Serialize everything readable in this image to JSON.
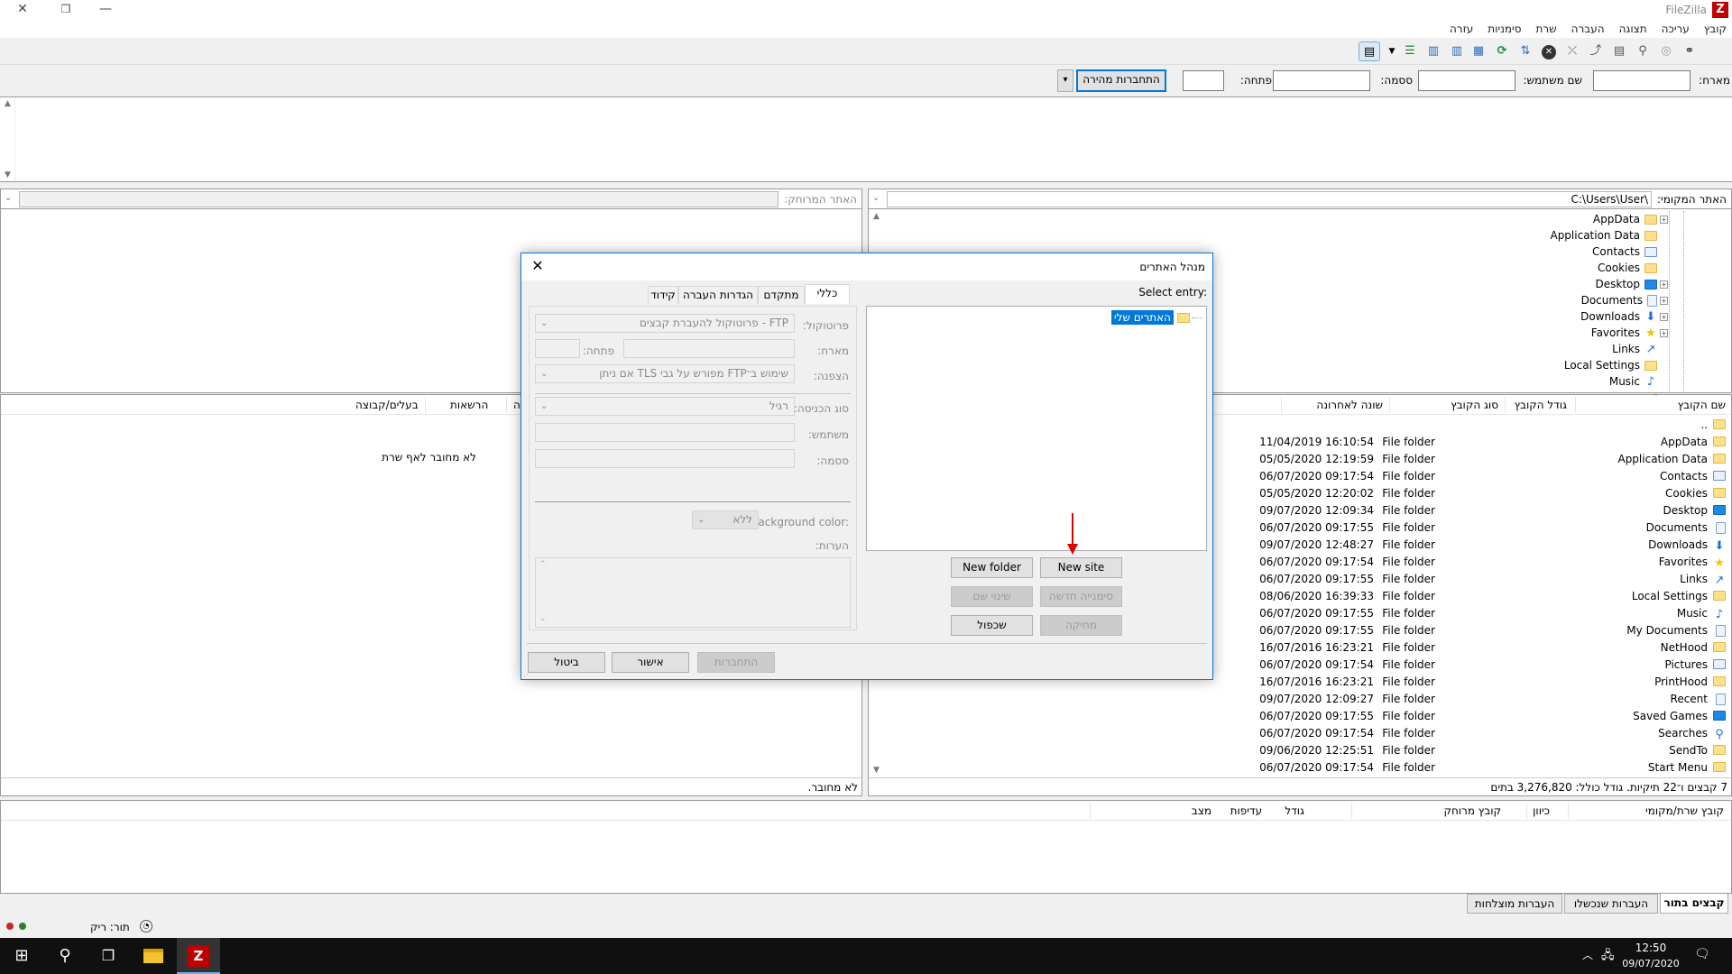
{
  "window": {
    "title": "FileZilla",
    "logo_letter": "Z",
    "controls": {
      "close": "✕",
      "restore": "❐",
      "minimize": "—"
    }
  },
  "menu": [
    "קובץ",
    "עריכה",
    "תצוגה",
    "העברה",
    "שרת",
    "סימניות",
    "עזרה"
  ],
  "quickconnect": {
    "host_label": "מארח:",
    "user_label": "שם משתמש:",
    "pass_label": "ססמה:",
    "port_label": "פתחה:",
    "connect_button": "התחברות מהירה",
    "dropdown_arrow": "▾"
  },
  "local": {
    "site_label": "האתר המקומי:",
    "path": "C:\\Users\\User\\",
    "tree": [
      {
        "name": "AppData",
        "icon": "folder",
        "expand": true
      },
      {
        "name": "Application Data",
        "icon": "folder",
        "expand": false
      },
      {
        "name": "Contacts",
        "icon": "card",
        "expand": false
      },
      {
        "name": "Cookies",
        "icon": "folder",
        "expand": false
      },
      {
        "name": "Desktop",
        "icon": "blue",
        "expand": true
      },
      {
        "name": "Documents",
        "icon": "doc",
        "expand": true
      },
      {
        "name": "Downloads",
        "icon": "down",
        "expand": true
      },
      {
        "name": "Favorites",
        "icon": "star",
        "expand": true
      },
      {
        "name": "Links",
        "icon": "link",
        "expand": false
      },
      {
        "name": "Local Settings",
        "icon": "folder",
        "expand": false
      },
      {
        "name": "Music",
        "icon": "music",
        "expand": false
      }
    ],
    "columns": [
      "שם הקובץ",
      "גודל הקובץ",
      "סוג הקובץ",
      "שונה לאחרונה"
    ],
    "parent_row": "..",
    "files": [
      {
        "name": "AppData",
        "icon": "folder",
        "type": "File folder",
        "modified": "11/04/2019 16:10:54"
      },
      {
        "name": "Application Data",
        "icon": "folder",
        "type": "File folder",
        "modified": "05/05/2020 12:19:59"
      },
      {
        "name": "Contacts",
        "icon": "card",
        "type": "File folder",
        "modified": "06/07/2020 09:17:54"
      },
      {
        "name": "Cookies",
        "icon": "folder",
        "type": "File folder",
        "modified": "05/05/2020 12:20:02"
      },
      {
        "name": "Desktop",
        "icon": "blue",
        "type": "File folder",
        "modified": "09/07/2020 12:09:34"
      },
      {
        "name": "Documents",
        "icon": "doc",
        "type": "File folder",
        "modified": "06/07/2020 09:17:55"
      },
      {
        "name": "Downloads",
        "icon": "down",
        "type": "File folder",
        "modified": "09/07/2020 12:48:27"
      },
      {
        "name": "Favorites",
        "icon": "star",
        "type": "File folder",
        "modified": "06/07/2020 09:17:54"
      },
      {
        "name": "Links",
        "icon": "link",
        "type": "File folder",
        "modified": "06/07/2020 09:17:55"
      },
      {
        "name": "Local Settings",
        "icon": "folder",
        "type": "File folder",
        "modified": "08/06/2020 16:39:33"
      },
      {
        "name": "Music",
        "icon": "music",
        "type": "File folder",
        "modified": "06/07/2020 09:17:55"
      },
      {
        "name": "My Documents",
        "icon": "doc",
        "type": "File folder",
        "modified": "06/07/2020 09:17:55"
      },
      {
        "name": "NetHood",
        "icon": "folder",
        "type": "File folder",
        "modified": "16/07/2016 16:23:21"
      },
      {
        "name": "Pictures",
        "icon": "card",
        "type": "File folder",
        "modified": "06/07/2020 09:17:54"
      },
      {
        "name": "PrintHood",
        "icon": "folder",
        "type": "File folder",
        "modified": "16/07/2016 16:23:21"
      },
      {
        "name": "Recent",
        "icon": "doc",
        "type": "File folder",
        "modified": "09/07/2020 12:09:27"
      },
      {
        "name": "Saved Games",
        "icon": "blue",
        "type": "File folder",
        "modified": "06/07/2020 09:17:55"
      },
      {
        "name": "Searches",
        "icon": "search",
        "type": "File folder",
        "modified": "06/07/2020 09:17:54"
      },
      {
        "name": "SendTo",
        "icon": "folder",
        "type": "File folder",
        "modified": "09/06/2020 12:25:51"
      },
      {
        "name": "Start Menu",
        "icon": "folder",
        "type": "File folder",
        "modified": "06/07/2020 09:17:54"
      }
    ],
    "status": "7 קבצים ו־22 תיקיות. גודל כולל: 3,276,820 בתים"
  },
  "remote": {
    "site_label": "האתר המרוחק:",
    "columns": [
      "בעלים/קבוצה",
      "הרשאות",
      "ה"
    ],
    "empty_message": "לא מחובר לאף שרת",
    "status": "לא מחובר."
  },
  "queue": {
    "columns": [
      "קובץ שרת/מקומי",
      "כיוון",
      "קובץ מרוחק",
      "גודל",
      "עדיפות",
      "מצב"
    ],
    "tabs": [
      "קבצים בתור",
      "העברות שנכשלו",
      "העברות מוצלחות"
    ],
    "status": "תור: ריק"
  },
  "dialog": {
    "title": "מנהל האתרים",
    "close": "✕",
    "select_entry": "Select entry:",
    "tree_root": "האתרים שלי",
    "buttons": {
      "new_site": "New site",
      "new_folder": "New folder",
      "new_bookmark": "סימנייה חדשה",
      "rename": "שינוי שם",
      "delete": "מחיקה",
      "duplicate": "שכפול",
      "connect": "התחברות",
      "ok": "אישור",
      "cancel": "ביטול"
    },
    "tabs": [
      "כללי",
      "מתקדם",
      "הגדרות העברה",
      "קידוד"
    ],
    "fields": {
      "protocol_label": "פרוטוקול:",
      "protocol_value": "FTP - פרוטוקול להעברת קבצים",
      "host_label": "מארח:",
      "port_label": "פתחה:",
      "encryption_label": "הצפנה:",
      "encryption_value": "שימוש ב־FTP מפורש על גבי TLS אם ניתן",
      "logon_label": "סוג הכניסה:",
      "logon_value": "רגיל",
      "user_label": "משתמש:",
      "pass_label": "ססמה:",
      "bg_label": "Background color:",
      "bg_value": "ללא",
      "comments_label": "הערות:"
    }
  },
  "taskbar": {
    "time": "12:50",
    "date": "09/07/2020"
  },
  "colors": {
    "accent": "#0078d7",
    "selection": "#0078d7",
    "annotation_arrow": "#e00000",
    "taskbar": "#101010"
  }
}
